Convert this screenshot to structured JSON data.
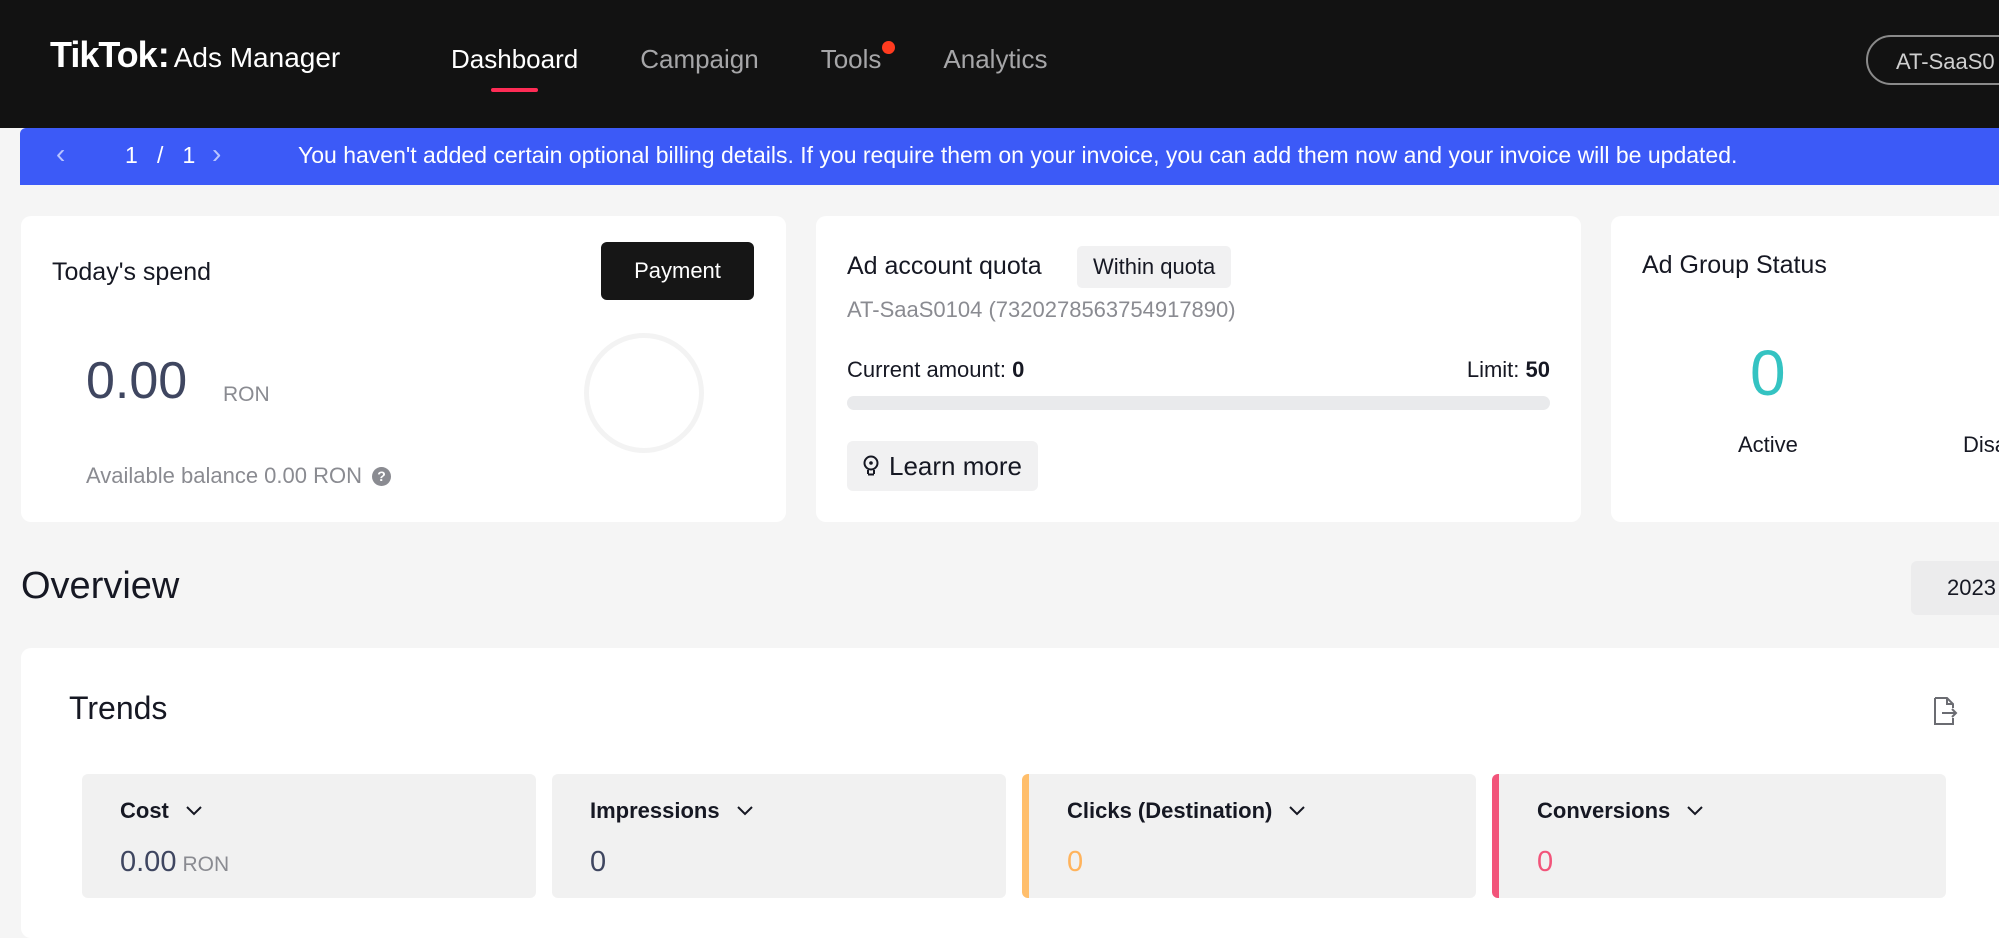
{
  "header": {
    "logo_brand": "TikTok",
    "logo_colon": ":",
    "logo_product": "Ads Manager",
    "nav": [
      {
        "label": "Dashboard",
        "active": true
      },
      {
        "label": "Campaign",
        "active": false
      },
      {
        "label": "Tools",
        "active": false,
        "has_dot": true
      },
      {
        "label": "Analytics",
        "active": false
      }
    ],
    "account_switcher": "AT-SaaS0"
  },
  "notice": {
    "pager_current": "1",
    "pager_sep": "/",
    "pager_total": "1",
    "message": "You haven't added certain optional billing details. If you require them on your invoice, you can add them now and your invoice will be updated.",
    "color": "#3c5af7"
  },
  "spend_card": {
    "title": "Today's spend",
    "payment_button": "Payment",
    "amount": "0.00",
    "currency": "RON",
    "available_balance": "Available balance 0.00 RON",
    "help_icon": "?"
  },
  "quota_card": {
    "title": "Ad account quota",
    "badge": "Within quota",
    "account": "AT-SaaS0104 (7320278563754917890)",
    "current_label": "Current amount: ",
    "current_value": "0",
    "limit_label": "Limit: ",
    "limit_value": "50",
    "progress_fraction": 0.0,
    "learn_more": "Learn more"
  },
  "status_card": {
    "title": "Ad Group Status",
    "active_count": "0",
    "active_label": "Active",
    "second_label": "Disa"
  },
  "overview": {
    "title": "Overview",
    "date": "2023"
  },
  "trends": {
    "title": "Trends",
    "metrics": [
      {
        "label": "Cost",
        "value": "0.00",
        "unit": "RON"
      },
      {
        "label": "Impressions",
        "value": "0",
        "unit": ""
      },
      {
        "label": "Clicks (Destination)",
        "value": "0",
        "unit": "",
        "color": "#ffbe6b"
      },
      {
        "label": "Conversions",
        "value": "0",
        "unit": "",
        "color": "#f2547a"
      }
    ]
  }
}
